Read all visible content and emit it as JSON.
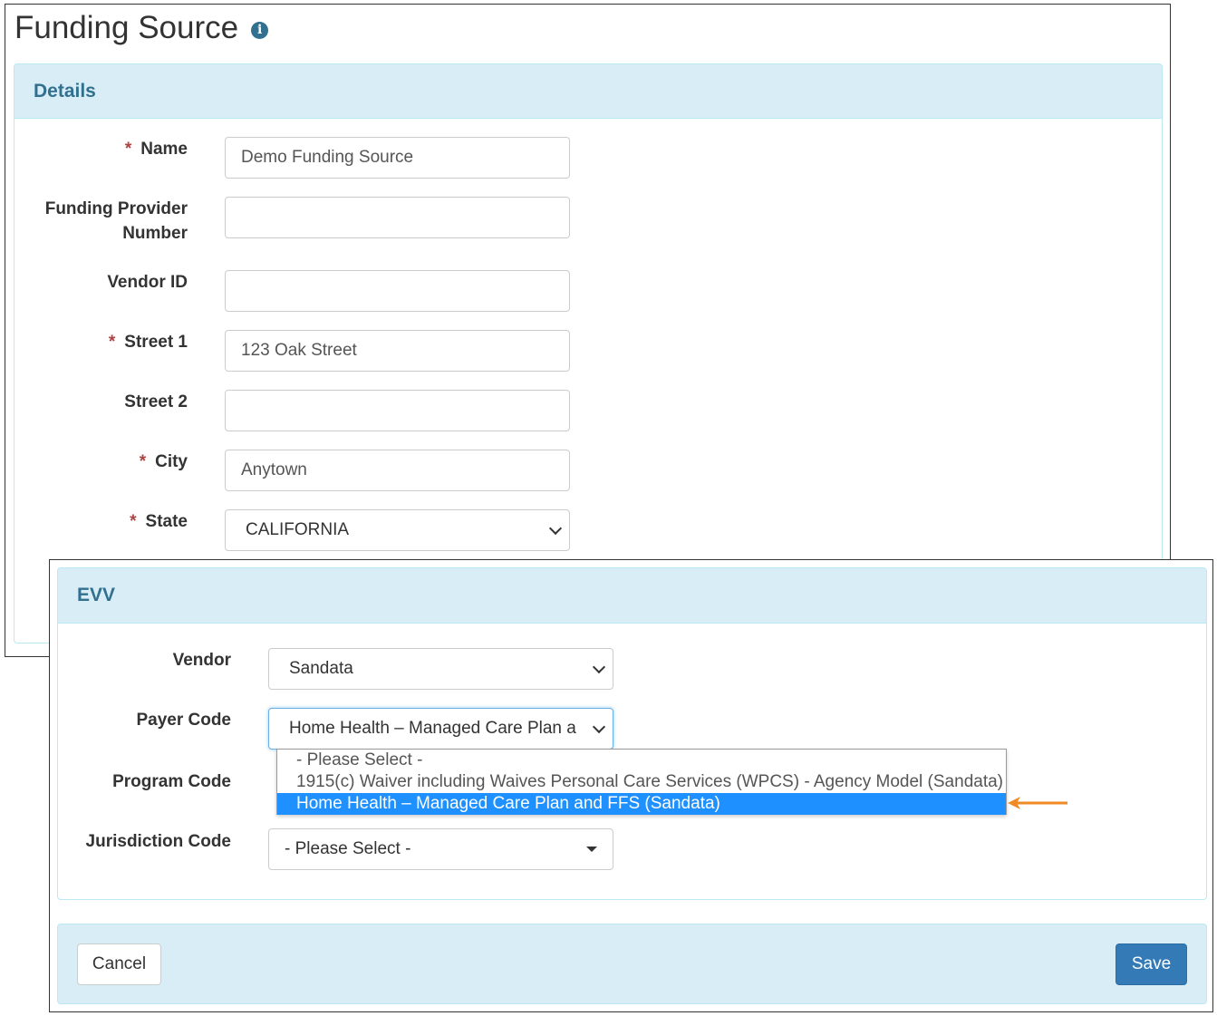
{
  "page": {
    "title": "Funding Source"
  },
  "details": {
    "heading": "Details",
    "fields": {
      "name": {
        "label": "Name",
        "value": "Demo Funding Source",
        "required": true
      },
      "funding_provider_number": {
        "label_line1": "Funding Provider",
        "label_line2": "Number",
        "value": ""
      },
      "vendor_id": {
        "label": "Vendor ID",
        "value": ""
      },
      "street1": {
        "label": "Street 1",
        "value": "123 Oak Street",
        "required": true
      },
      "street2": {
        "label": "Street 2",
        "value": ""
      },
      "city": {
        "label": "City",
        "value": "Anytown",
        "required": true
      },
      "state": {
        "label": "State",
        "value": "CALIFORNIA",
        "required": true
      }
    },
    "required_marker": "*"
  },
  "evv": {
    "heading": "EVV",
    "vendor": {
      "label": "Vendor",
      "value": "Sandata"
    },
    "payer_code": {
      "label": "Payer Code",
      "value": "Home Health – Managed Care Plan a",
      "options": [
        "- Please Select -",
        "1915(c) Waiver including Waives Personal Care Services (WPCS) - Agency Model (Sandata)",
        "Home Health – Managed Care Plan and FFS (Sandata)"
      ],
      "highlighted_index": 2
    },
    "program_code": {
      "label": "Program Code"
    },
    "jurisdiction_code": {
      "label": "Jurisdiction Code",
      "value": "- Please Select -"
    }
  },
  "footer": {
    "cancel_label": "Cancel",
    "save_label": "Save"
  },
  "colors": {
    "panel_header_bg": "#d9edf7",
    "panel_header_text": "#31708f",
    "required": "#a94442",
    "save_button": "#337ab7",
    "highlight": "#1e90ff",
    "annotation_arrow": "#f08a24"
  }
}
